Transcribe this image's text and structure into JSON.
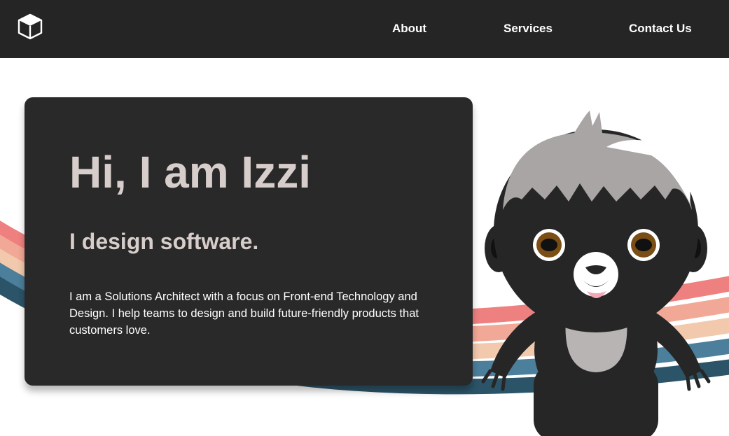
{
  "header": {
    "logo_icon": "cube-logo-icon",
    "nav": [
      {
        "label": "About"
      },
      {
        "label": "Services"
      },
      {
        "label": "Contact Us"
      }
    ]
  },
  "hero": {
    "title": "Hi, I am Izzi",
    "subtitle": "I design software.",
    "description": "I am a Solutions Architect with a focus on Front-end Technology and Design. I help teams to design and build future-friendly products that customers love."
  },
  "illustration": {
    "mascot": "sloth-mascot-illustration",
    "background": "rainbow-arcs-decoration"
  },
  "colors": {
    "header_bg": "#252525",
    "card_bg": "#292929",
    "heading_text": "#d7cecb",
    "body_text": "#ffffff",
    "arc_red": "#ef8080",
    "arc_salmon": "#f2a896",
    "arc_peach": "#f2c9ad",
    "arc_blue": "#4b7f9b",
    "arc_navy": "#2b5468"
  }
}
